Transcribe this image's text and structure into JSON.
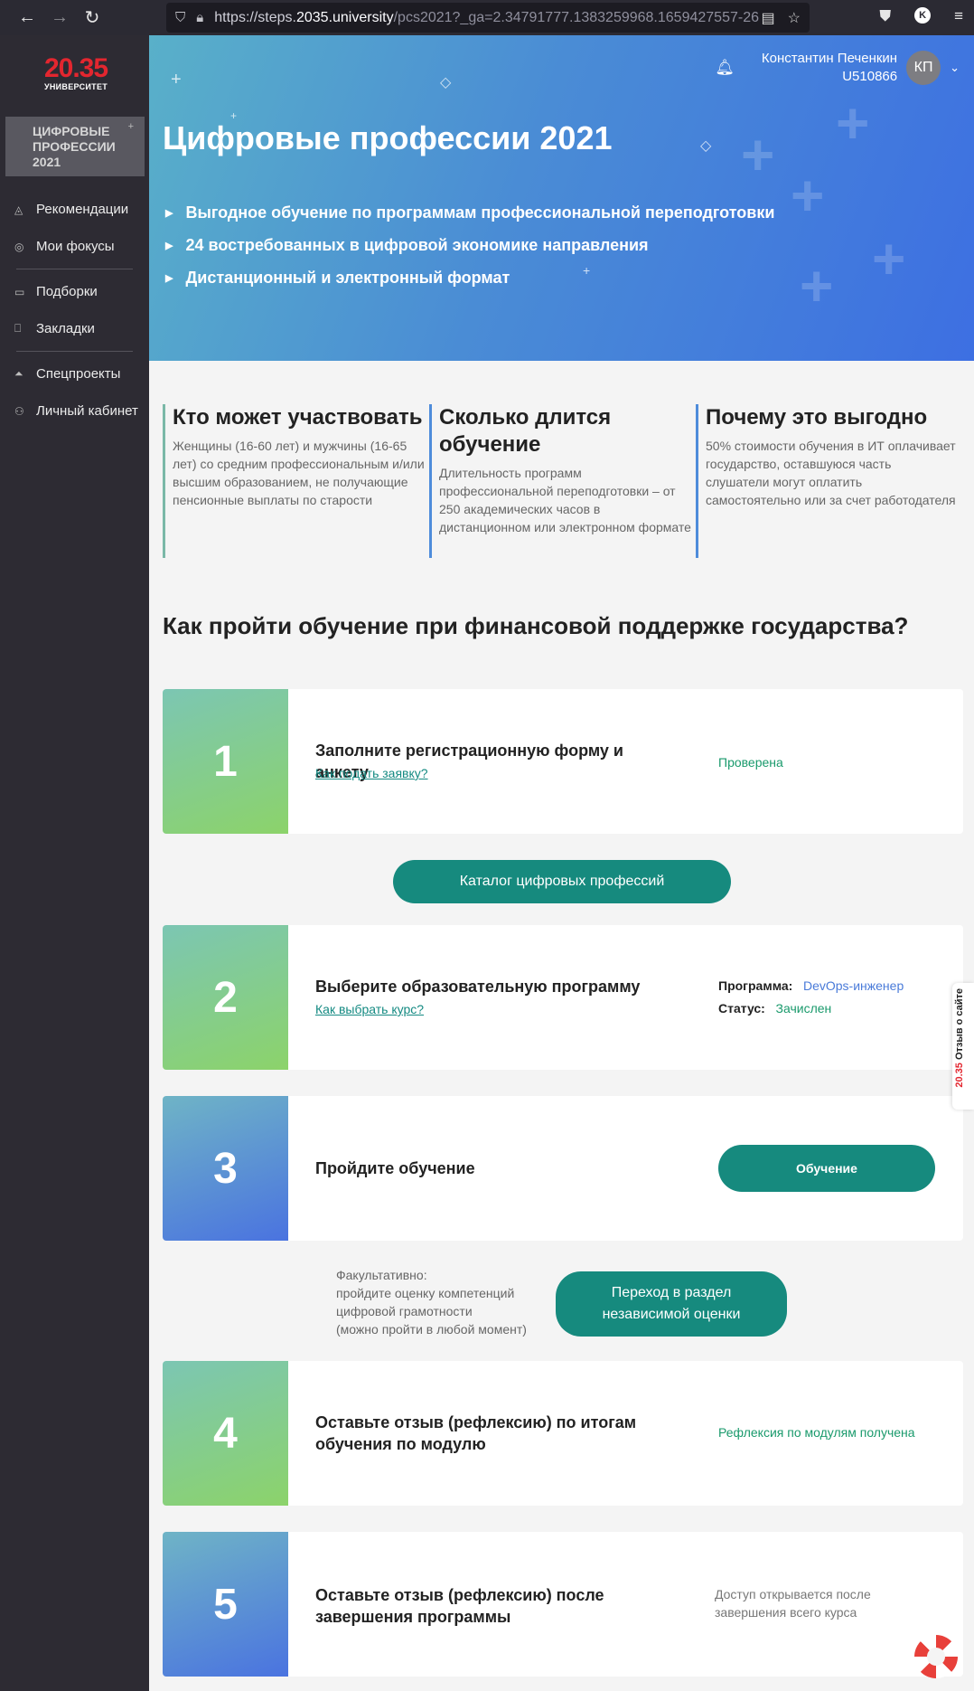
{
  "browser": {
    "url_protocol": "https://steps.",
    "url_host": "2035.university",
    "url_path": "/pcs2021?_ga=2.34791777.1383259968.1659427557-26",
    "profile_letter": "K"
  },
  "sidebar": {
    "logo_number": "20.35",
    "logo_text": "УНИВЕРСИТЕТ",
    "badge_title": "ЦИФРОВЫЕ ПРОФЕССИИ 2021",
    "items": [
      {
        "label": "Рекомендации"
      },
      {
        "label": "Мои фокусы"
      },
      {
        "label": "Подборки"
      },
      {
        "label": "Закладки"
      },
      {
        "label": "Спецпроекты"
      },
      {
        "label": "Личный кабинет"
      }
    ]
  },
  "header": {
    "user_name": "Константин Печенкин",
    "user_id": "U510866",
    "avatar_initials": "КП"
  },
  "hero": {
    "title": "Цифровые профессии 2021",
    "bullets": [
      "Выгодное обучение по программам профессиональной переподготовки",
      "24 востребованных в цифровой экономике направления",
      "Дистанционный и электронный формат"
    ]
  },
  "info": [
    {
      "title": "Кто может участвовать",
      "text": "Женщины (16-60 лет) и мужчины (16-65 лет) со средним профессиональным и/или высшим образованием, не получающие пенсионные выплаты по старости"
    },
    {
      "title": "Сколько длится обучение",
      "text": "Длительность программ профессиональной переподготовки – от 250 академических часов в дистанционном или электронном формате"
    },
    {
      "title": "Почему это выгодно",
      "text": "50% стоимости обучения в ИТ оплачивает государство, оставшуюся часть слушатели могут оплатить самостоятельно или за счет работодателя"
    }
  ],
  "steps_section": {
    "title": "Как пройти обучение при финансовой поддержке государства?",
    "catalog_button": "Каталог цифровых профессий",
    "steps": [
      {
        "number": "1",
        "title": "Заполните регистрационную форму и анкету",
        "link": "Как подать заявку?",
        "status": "Проверена"
      },
      {
        "number": "2",
        "title": "Выберите образовательную программу",
        "link": "Как выбрать курс?",
        "program_label": "Программа:",
        "program_value": "DevOps-инженер",
        "status_label": "Статус:",
        "status_value": "Зачислен"
      },
      {
        "number": "3",
        "title": "Пройдите обучение",
        "button": "Обучение"
      },
      {
        "number": "4",
        "title": "Оставьте отзыв (рефлексию) по итогам обучения по модулю",
        "status": "Рефлексия по модулям получена"
      },
      {
        "number": "5",
        "title": "Оставьте отзыв (рефлексию) после завершения программы",
        "status": "Доступ открывается после завершения всего курса"
      }
    ],
    "optional_text_1": "Факультативно:",
    "optional_text_2": "пройдите оценку компетенций",
    "optional_text_3": "цифровой грамотности",
    "optional_text_4": "(можно пройти в любой момент)",
    "optional_button": "Переход в раздел независимой оценки"
  },
  "feedback_tab": {
    "brand": "20.35",
    "label": "Отзыв о сайте"
  },
  "colors": {
    "accent": "#168a7e",
    "brand_red": "#e3262f",
    "sidebar": "#2d2b33",
    "link_blue": "#4a7bd9"
  }
}
